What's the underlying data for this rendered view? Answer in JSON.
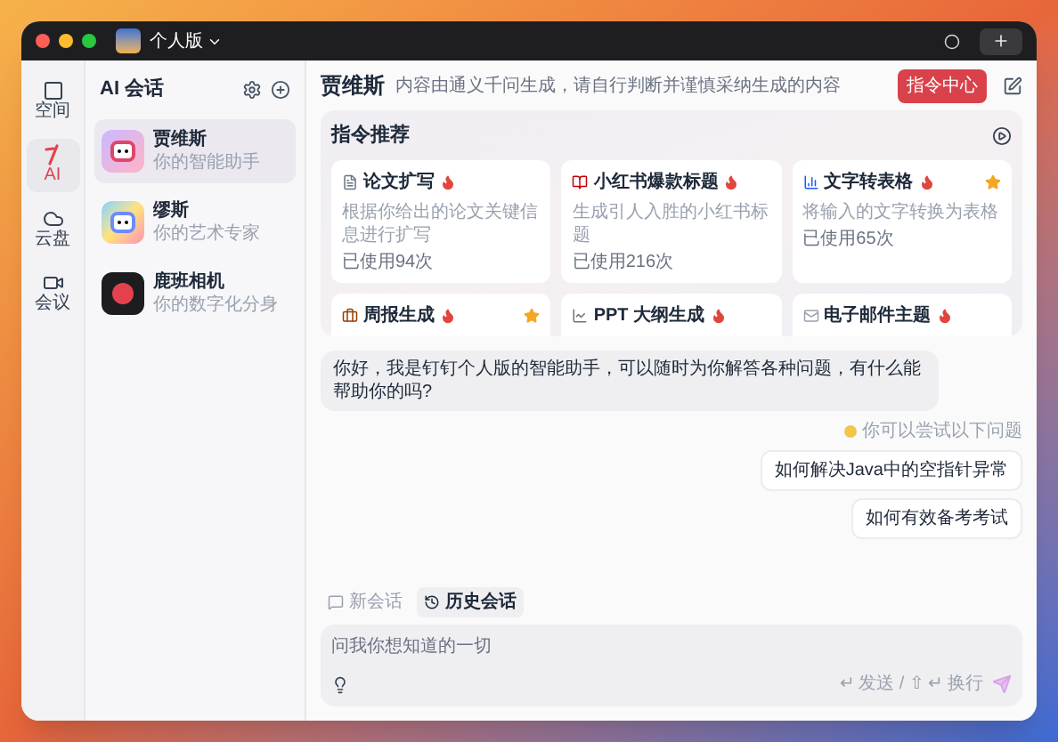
{
  "window": {
    "edition": "个人版"
  },
  "nav": [
    {
      "label": "空间",
      "selected": false
    },
    {
      "label": "AI",
      "selected": true
    },
    {
      "label": "云盘",
      "selected": false
    },
    {
      "label": "会议",
      "selected": false
    }
  ],
  "sessions": {
    "title": "AI 会话",
    "items": [
      {
        "name": "贾维斯",
        "subtitle": "你的智能助手",
        "selected": true
      },
      {
        "name": "缪斯",
        "subtitle": "你的艺术专家",
        "selected": false
      },
      {
        "name": "鹿班相机",
        "subtitle": "你的数字化分身",
        "selected": false
      }
    ]
  },
  "header": {
    "name": "贾维斯",
    "disclaimer": "内容由通义千问生成，请自行判断并谨慎采纳生成的内容",
    "button": "指令中心"
  },
  "recommendations": {
    "title": "指令推荐",
    "cards": [
      {
        "title": "论文扩写",
        "hot": true,
        "starred": false,
        "description": "根据你给出的论文关键信息进行扩写",
        "usage": "已使用94次"
      },
      {
        "title": "小红书爆款标题",
        "hot": true,
        "starred": false,
        "description": "生成引人入胜的小红书标题",
        "usage": "已使用216次"
      },
      {
        "title": "文字转表格",
        "hot": true,
        "starred": true,
        "description": "将输入的文字转换为表格",
        "usage": "已使用65次"
      },
      {
        "title": "周报生成",
        "hot": true,
        "starred": true
      },
      {
        "title": "PPT 大纲生成",
        "hot": true,
        "starred": false
      },
      {
        "title": "电子邮件主题",
        "hot": true,
        "starred": false
      }
    ]
  },
  "chat": {
    "greeting": "你好，我是钉钉个人版的智能助手，可以随时为你解答各种问题，有什么能帮助你的吗?",
    "hint": "你可以尝试以下问题",
    "suggestions": [
      "如何解决Java中的空指针异常",
      "如何有效备考考试"
    ]
  },
  "tabs": [
    {
      "label": "新会话",
      "selected": false
    },
    {
      "label": "历史会话",
      "selected": true
    }
  ],
  "input": {
    "placeholder": "问我你想知道的一切",
    "shortcut_hint": "↵ 发送 / ⇧ ↵ 换行"
  }
}
